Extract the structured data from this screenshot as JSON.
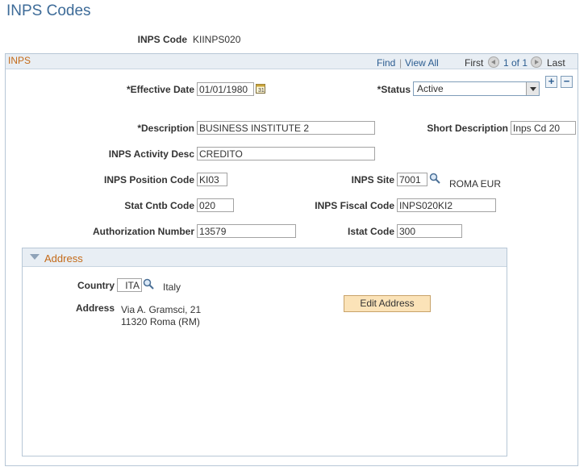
{
  "page_title": "INPS Codes",
  "inps_code": {
    "label": "INPS Code",
    "value": "KIINPS020"
  },
  "section": {
    "title": "INPS",
    "find": "Find",
    "separator": "|",
    "view_all": "View All",
    "first": "First",
    "pager": "1 of 1",
    "last": "Last",
    "add_symbol": "+",
    "remove_symbol": "−"
  },
  "fields": {
    "effective_date": {
      "label": "*Effective Date",
      "value": "01/01/1980"
    },
    "status": {
      "label": "*Status",
      "value": "Active"
    },
    "description": {
      "label": "*Description",
      "value": "BUSINESS INSTITUTE 2"
    },
    "short_description": {
      "label": "Short Description",
      "value": "Inps Cd 20"
    },
    "activity_desc": {
      "label": "INPS Activity Desc",
      "value": "CREDITO"
    },
    "position_code": {
      "label": "INPS Position Code",
      "value": "KI03"
    },
    "inps_site": {
      "label": "INPS Site",
      "value": "7001",
      "desc": "ROMA EUR"
    },
    "stat_cntb_code": {
      "label": "Stat Cntb Code",
      "value": "020"
    },
    "fiscal_code": {
      "label": "INPS Fiscal Code",
      "value": "INPS020KI2"
    },
    "authorization_number": {
      "label": "Authorization Number",
      "value": "13579"
    },
    "istat_code": {
      "label": "Istat Code",
      "value": "300"
    }
  },
  "address": {
    "title": "Address",
    "country_label": "Country",
    "country_value": "ITA",
    "country_name": "Italy",
    "address_label": "Address",
    "line1": "Via A. Gramsci, 21",
    "line2": "11320 Roma (RM)",
    "edit_button": "Edit Address"
  },
  "icons": {
    "calendar": "calendar-icon",
    "lookup": "magnifier-icon",
    "collapse": "triangle-down-icon"
  }
}
